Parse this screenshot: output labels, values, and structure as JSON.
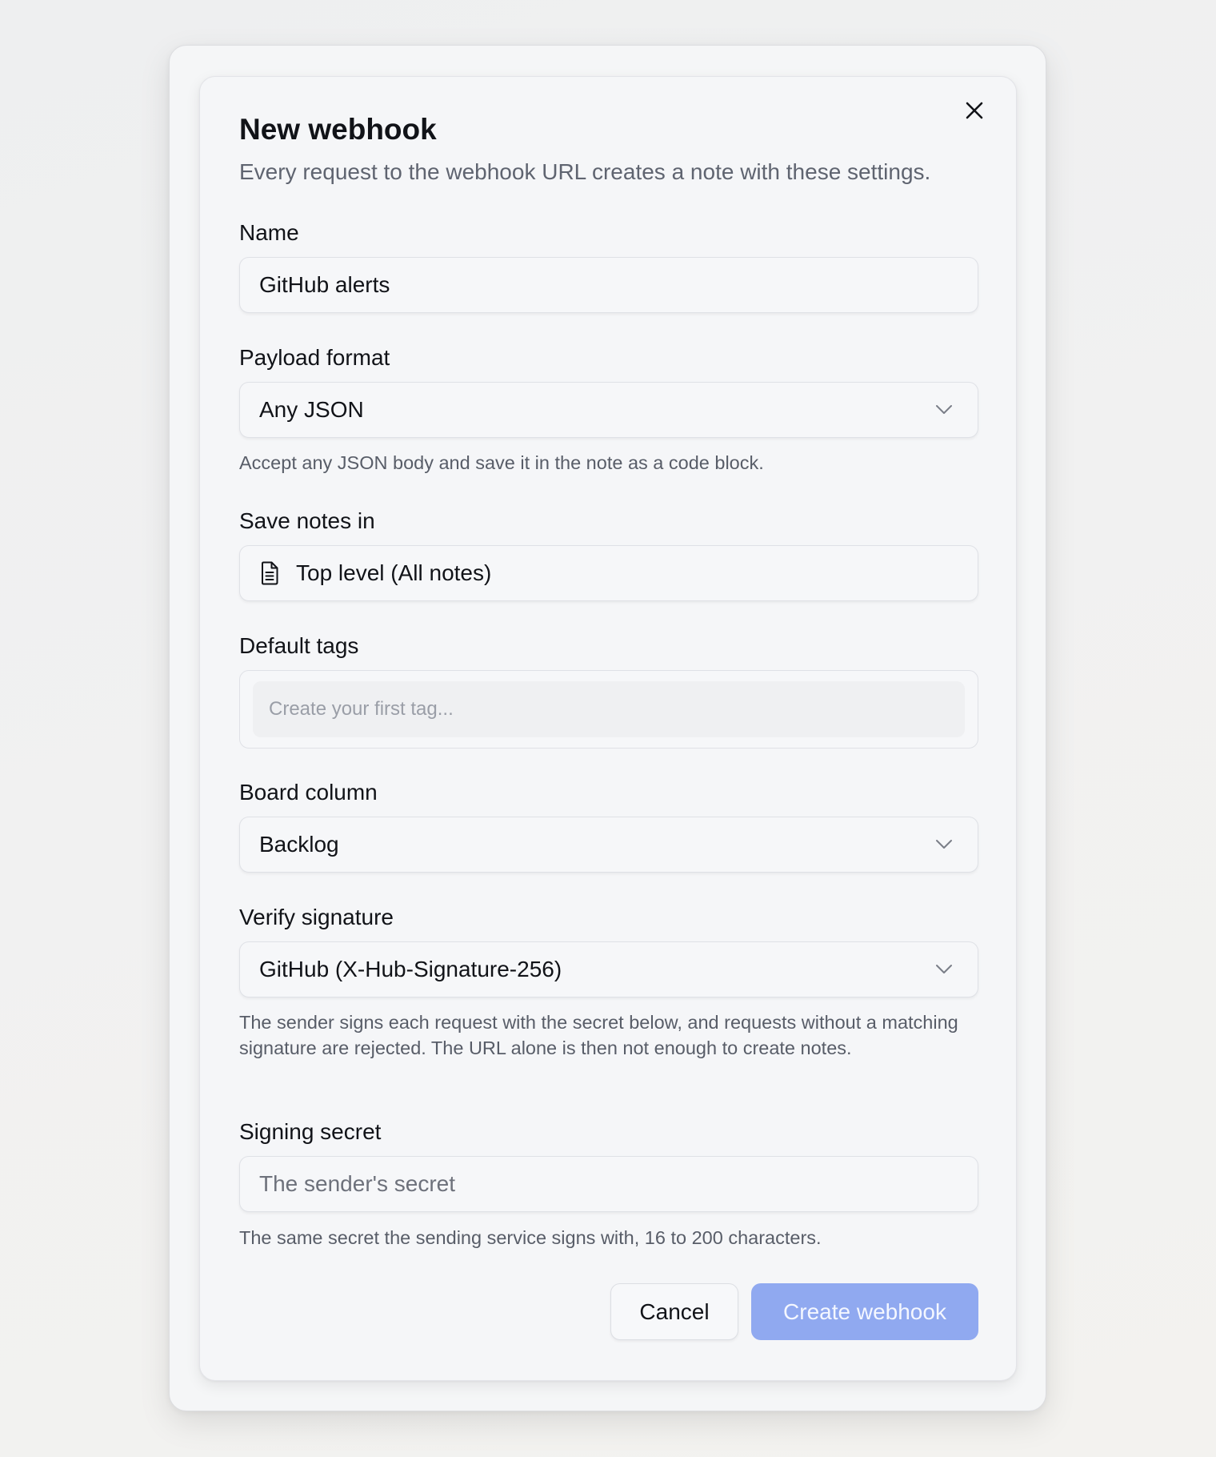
{
  "dialog": {
    "title": "New webhook",
    "subtitle": "Every request to the webhook URL creates a note with these settings.",
    "close_icon": "close-icon"
  },
  "fields": {
    "name": {
      "label": "Name",
      "value": "GitHub alerts"
    },
    "payload_format": {
      "label": "Payload format",
      "value": "Any JSON",
      "help": "Accept any JSON body and save it in the note as a code block."
    },
    "save_notes_in": {
      "label": "Save notes in",
      "value": "Top level (All notes)",
      "icon": "document-icon"
    },
    "default_tags": {
      "label": "Default tags",
      "placeholder": "Create your first tag..."
    },
    "board_column": {
      "label": "Board column",
      "value": "Backlog"
    },
    "verify_signature": {
      "label": "Verify signature",
      "value": "GitHub (X-Hub-Signature-256)",
      "help": "The sender signs each request with the secret below, and requests without a matching signature are rejected. The URL alone is then not enough to create notes."
    },
    "signing_secret": {
      "label": "Signing secret",
      "placeholder": "The sender's secret",
      "value": "",
      "help": "The same secret the sending service signs with, 16 to 200 characters."
    }
  },
  "actions": {
    "cancel_label": "Cancel",
    "create_label": "Create webhook"
  },
  "colors": {
    "primary_button": "#90a9f0",
    "page_background": "#efefef",
    "dialog_background": "#f5f6f8"
  }
}
